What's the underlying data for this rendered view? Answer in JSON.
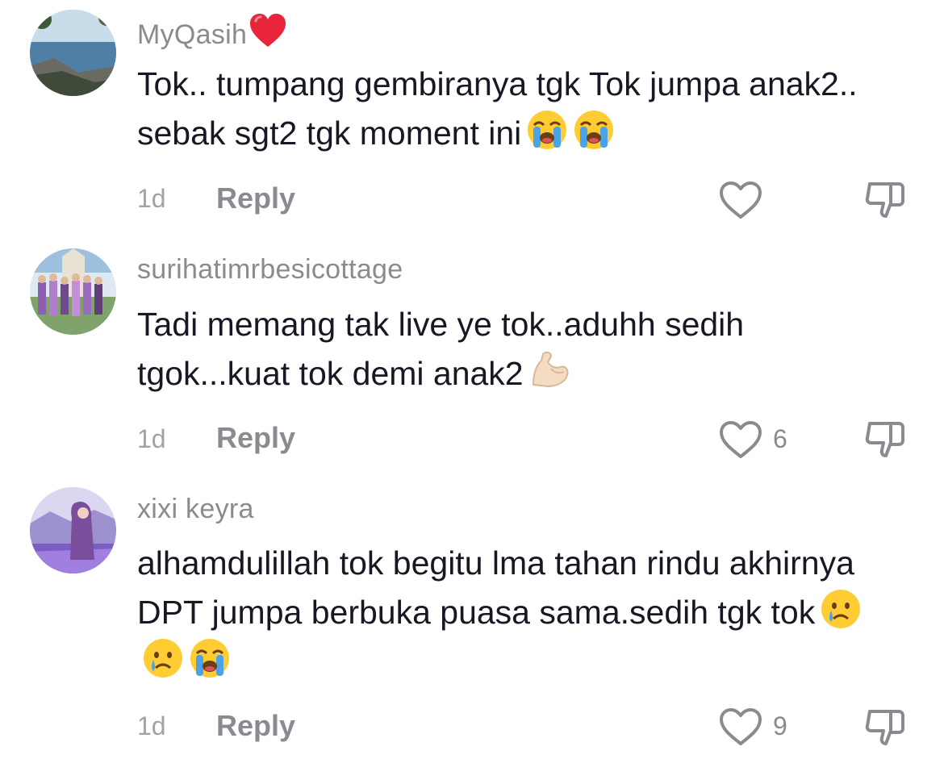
{
  "comments": [
    {
      "username": "MyQasih",
      "username_emoji": "red-heart",
      "text": "Tok.. tumpang gembiranya tgk Tok jumpa anak2.. sebak sgt2 tgk moment ini",
      "emojis": [
        "loudly-crying-face",
        "loudly-crying-face"
      ],
      "time": "1d",
      "reply_label": "Reply",
      "likes": ""
    },
    {
      "username": "surihatimrbesicottage",
      "text": "Tadi memang tak live ye tok..aduhh sedih tgok...kuat tok demi anak2",
      "emojis": [
        "flexed-biceps"
      ],
      "time": "1d",
      "reply_label": "Reply",
      "likes": "6"
    },
    {
      "username": "xixi keyra",
      "text": "alhamdulillah tok begitu lma tahan rindu akhirnya DPT jumpa berbuka puasa sama.sedih tgk tok",
      "emojis": [
        "crying-face",
        "crying-face",
        "loudly-crying-face"
      ],
      "time": "1d",
      "reply_label": "Reply",
      "likes": "9"
    }
  ],
  "colors": {
    "text": "#161823",
    "secondary": "#8a8b91",
    "heart": "#fe2c55"
  }
}
